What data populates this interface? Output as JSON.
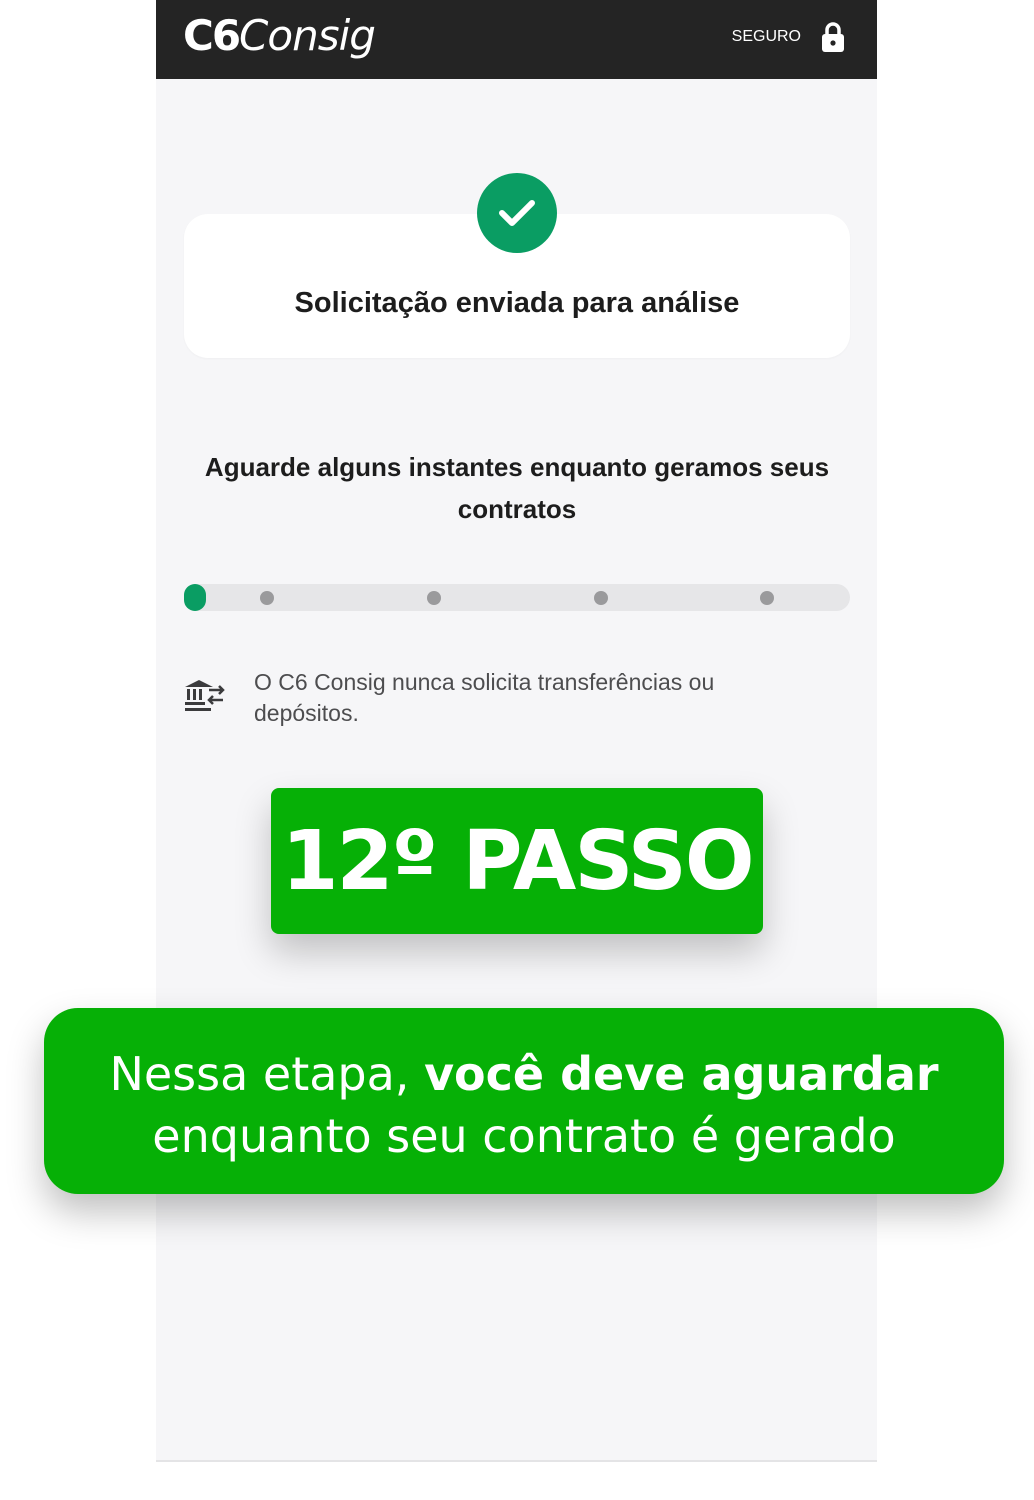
{
  "header": {
    "logo_c6": "C6",
    "logo_consig": "Consig",
    "secure_label": "SEGURO",
    "lock_icon": "lock-icon",
    "background": "#242424"
  },
  "status_card": {
    "icon": "check-icon",
    "icon_color": "#0a9d63",
    "title": "Solicitação enviada para análise"
  },
  "waiting": {
    "message": "Aguarde alguns instantes enquanto geramos seus contratos",
    "progress_steps_total": 5,
    "progress_step_current": 1
  },
  "notice": {
    "icon": "bank-transfer-icon",
    "text": "O C6 Consig nunca solicita transferências ou depósitos."
  },
  "overlay": {
    "step_badge": "12º PASSO",
    "caption_line1_regular": "Nessa etapa, ",
    "caption_line1_bold": "você deve aguardar",
    "caption_line2": "enquanto seu contrato é gerado",
    "accent_color": "#06b006"
  }
}
